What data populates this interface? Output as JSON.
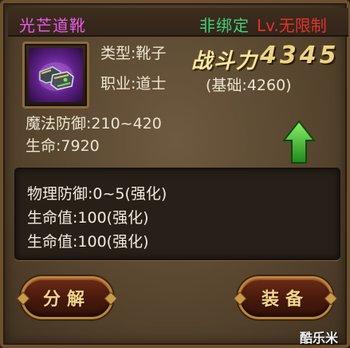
{
  "item": {
    "name": "光芒道靴",
    "bind_status": "非绑定",
    "level_requirement": "Lv.无限制",
    "type": "类型:靴子",
    "profession": "职业:道士",
    "combat_power_label": "战斗力",
    "combat_power_value": "4345",
    "base_value": "(基础:4260)",
    "magic_defense": "魔法防御:210~420",
    "hp": "生命:7920"
  },
  "bonuses": [
    "物理防御:0~5(强化)",
    "生命值:100(强化)",
    "生命值:100(强化)"
  ],
  "buttons": {
    "decompose": "分解",
    "equip": "装备"
  },
  "watermark": "酷乐米",
  "colors": {
    "name": "#e85ae8",
    "bind": "#3fd07a",
    "level": "#e0332b",
    "upgrade_arrow": "#3cb52e"
  },
  "icons": {
    "item": "boots-icon",
    "upgrade": "green-up-arrow-icon"
  }
}
